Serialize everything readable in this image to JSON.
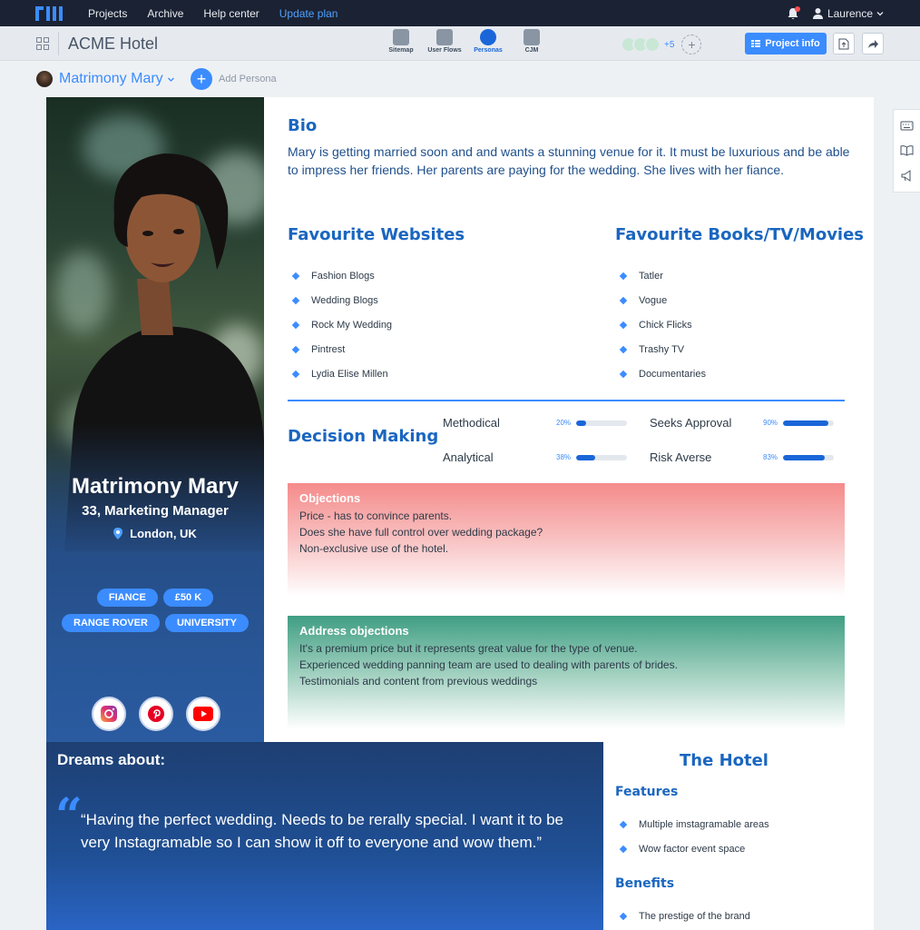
{
  "topnav": {
    "links": [
      "Projects",
      "Archive",
      "Help center"
    ],
    "update": "Update plan",
    "user": "Laurence"
  },
  "project": {
    "title": "ACME Hotel",
    "views": [
      "Sitemap",
      "User Flows",
      "Personas",
      "CJM"
    ],
    "active_view": "Personas",
    "extra_collaborators": "+5",
    "info_button": "Project info"
  },
  "persona_bar": {
    "name": "Matrimony Mary",
    "add_label": "Add Persona"
  },
  "persona": {
    "name": "Matrimony Mary",
    "role": "33, Marketing Manager",
    "location": "London, UK",
    "tags": [
      "FIANCE",
      "£50 K",
      "RANGE ROVER",
      "UNIVERSITY"
    ]
  },
  "bio": {
    "title": "Bio",
    "text": "Mary is getting married soon and and wants a stunning venue for it. It must be luxurious and be able to impress her friends. Her parents are paying for the wedding. She lives with her fiance."
  },
  "websites": {
    "title": "Favourite Websites",
    "items": [
      "Fashion Blogs",
      "Wedding Blogs",
      "Rock My Wedding",
      "Pintrest",
      "Lydia Elise Millen"
    ]
  },
  "media": {
    "title": "Favourite Books/TV/Movies",
    "items": [
      "Tatler",
      "Vogue",
      "Chick Flicks",
      "Trashy TV",
      "Documentaries"
    ]
  },
  "decision": {
    "title": "Decision Making",
    "metrics": [
      {
        "label": "Methodical",
        "pct": "20%",
        "value": 20
      },
      {
        "label": "Seeks Approval",
        "pct": "90%",
        "value": 90
      },
      {
        "label": "Analytical",
        "pct": "38%",
        "value": 38
      },
      {
        "label": "Risk Averse",
        "pct": "83%",
        "value": 83
      }
    ]
  },
  "objections": {
    "title": "Objections",
    "lines": [
      "Price - has to convince parents.",
      "Does she have full control over wedding package?",
      "Non-exclusive use of the hotel."
    ]
  },
  "address": {
    "title": "Address objections",
    "lines": [
      "It's a premium price but it represents great value for the type of venue.",
      "Experienced wedding panning team are used to dealing with parents of brides.",
      "Testimonials and content from previous weddings"
    ]
  },
  "dreams": {
    "title": "Dreams about:",
    "quote": "“Having the perfect wedding. Needs to be rerally special. I want it to be very Instagramable so I can show it off to everyone and wow them.”"
  },
  "hotel": {
    "title": "The Hotel",
    "features_title": "Features",
    "features": [
      "Multiple imstagramable areas",
      "Wow factor event space"
    ],
    "benefits_title": "Benefits",
    "benefits": [
      "The prestige of the brand"
    ]
  },
  "colors": {
    "accent": "#3b8cff",
    "heading": "#1a66c0",
    "nav": "#1b2233",
    "objections": "#f58b8b",
    "address": "#3f9e83"
  }
}
